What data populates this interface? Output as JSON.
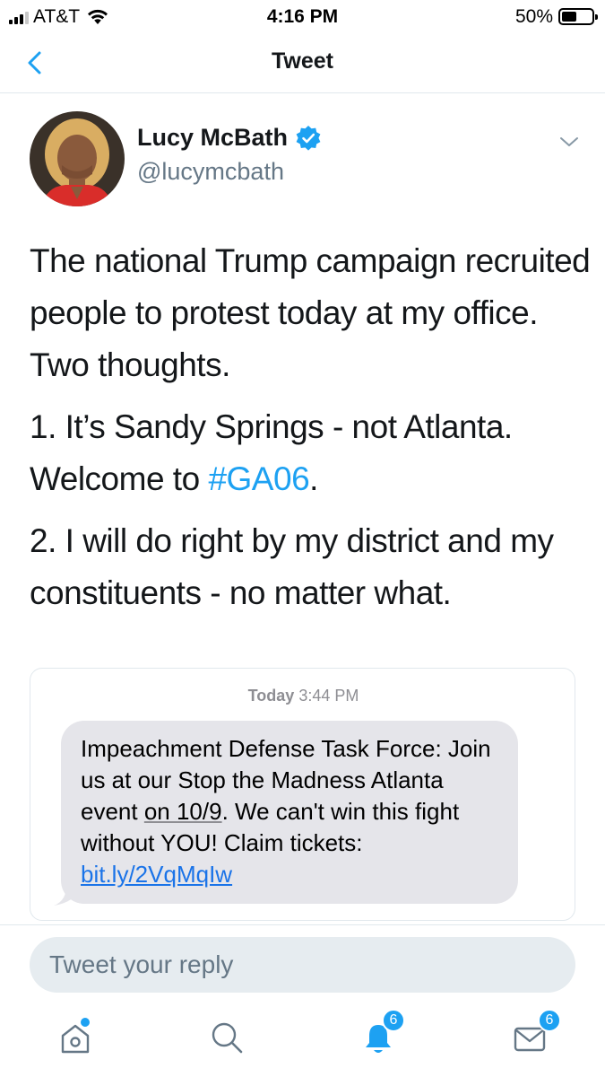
{
  "status_bar": {
    "carrier": "AT&T",
    "time": "4:16 PM",
    "battery_percent": "50%",
    "battery_level": 0.5,
    "icons": [
      "signal-icon",
      "wifi-icon",
      "battery-icon"
    ]
  },
  "nav": {
    "title": "Tweet",
    "back_icon": "chevron-left-icon"
  },
  "tweet": {
    "author_name": "Lucy McBath",
    "author_handle": "@lucymcbath",
    "verified": true,
    "paragraphs": [
      "The national Trump campaign recruited people to protest today at my office. Two thoughts.",
      "1. It’s Sandy Springs - not Atlanta.",
      "2. I will do right by my district and my constituents - no matter what."
    ],
    "welcome_text": "Welcome to ",
    "hashtag": "#GA06",
    "hashtag_suffix": ".",
    "accent_color": "#1da1f2"
  },
  "quoted_image": {
    "time_day": "Today",
    "time_clock": "3:44 PM",
    "message_prefix": "Impeachment Defense Task Force: Join us at our Stop the Madness Atlanta event ",
    "message_date": "on 10/9",
    "message_middle": ". We can't win this fight without YOU! Claim tickets: ",
    "message_link": "bit.ly/2VqMqIw"
  },
  "reply": {
    "placeholder": "Tweet your reply"
  },
  "tabbar": {
    "items": [
      {
        "icon": "home-icon",
        "badge": ""
      },
      {
        "icon": "search-icon",
        "badge": ""
      },
      {
        "icon": "notifications-bell-icon",
        "badge": "6"
      },
      {
        "icon": "messages-envelope-icon",
        "badge": "6"
      }
    ]
  }
}
